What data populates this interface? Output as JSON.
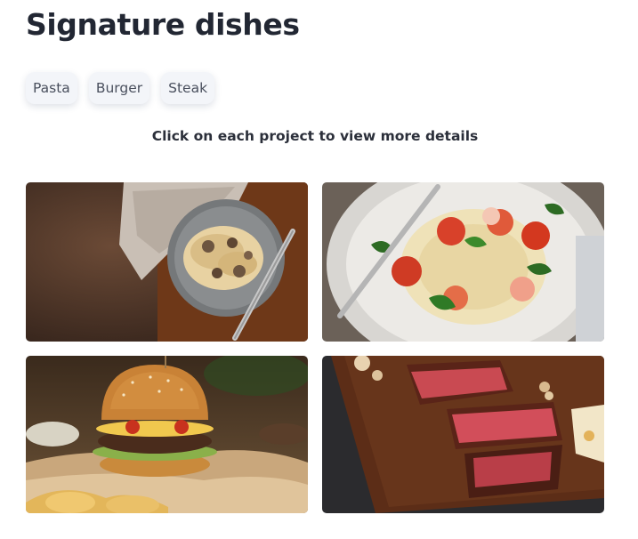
{
  "page": {
    "title": "Signature dishes",
    "hint": "Click on each project to view more details"
  },
  "filters": [
    {
      "label": "Pasta"
    },
    {
      "label": "Burger"
    },
    {
      "label": "Steak"
    }
  ],
  "gallery": [
    {
      "subject": "fettuccine-mushroom-pasta-photo"
    },
    {
      "subject": "spaghetti-tomato-basil-photo"
    },
    {
      "subject": "sesame-cheeseburger-photo"
    },
    {
      "subject": "sliced-steak-on-board-photo"
    }
  ]
}
